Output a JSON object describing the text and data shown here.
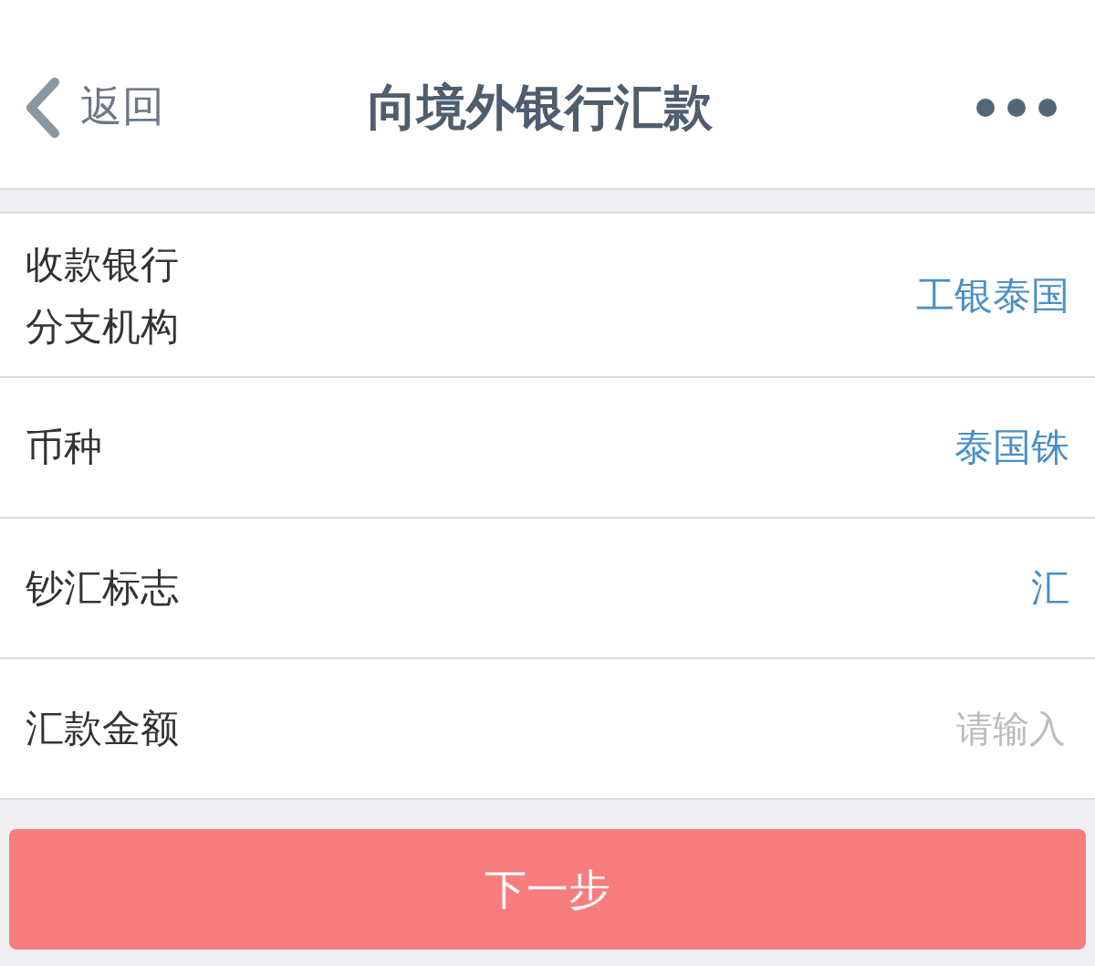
{
  "header": {
    "back_label": "返回",
    "title": "向境外银行汇款"
  },
  "rows": [
    {
      "kind": "value",
      "label": "收款银行分支机构",
      "value": "工银泰国"
    },
    {
      "kind": "value",
      "label": "币种",
      "value": "泰国铢"
    },
    {
      "kind": "value",
      "label": "钞汇标志",
      "value": "汇"
    },
    {
      "kind": "input",
      "label": "汇款金额",
      "placeholder": "请输入"
    }
  ],
  "next_button": "下一步"
}
